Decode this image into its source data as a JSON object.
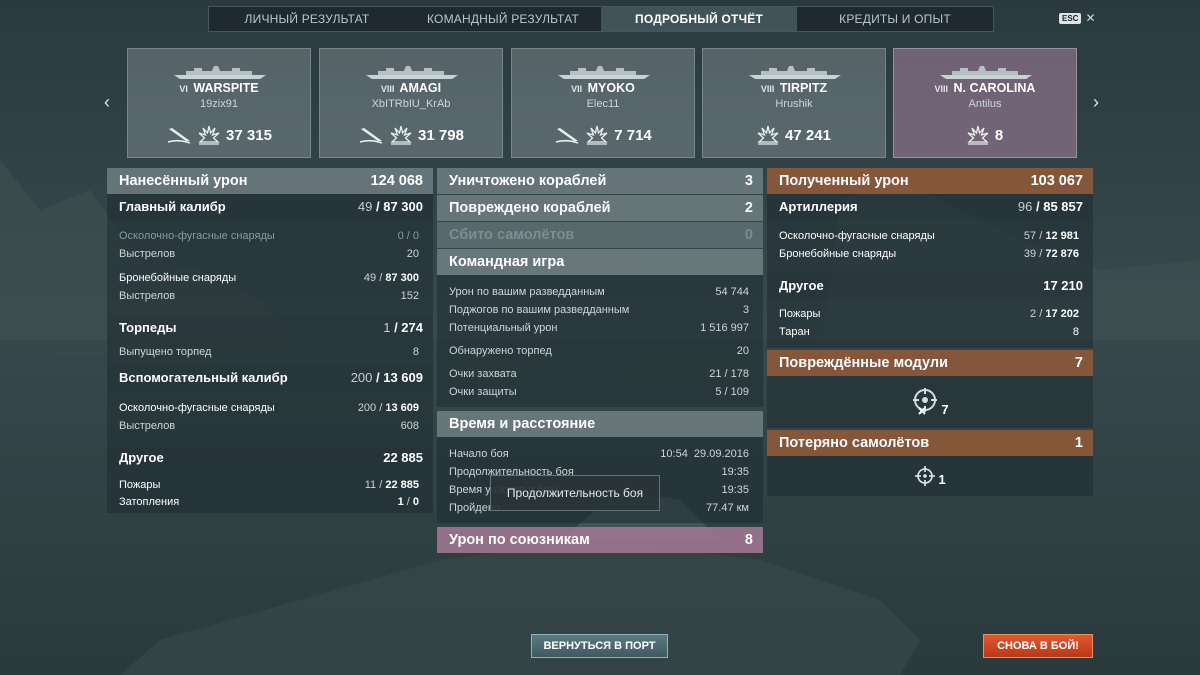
{
  "tabs": [
    "ЛИЧНЫЙ РЕЗУЛЬТАТ",
    "КОМАНДНЫЙ РЕЗУЛЬТАТ",
    "ПОДРОБНЫЙ ОТЧЁТ",
    "КРЕДИТЫ И ОПЫТ"
  ],
  "active_tab": "ПОДРОБНЫЙ ОТЧЁТ",
  "esc": {
    "key": "ESC",
    "close": "✕"
  },
  "nav": {
    "prev": "‹",
    "next": "›"
  },
  "cards": [
    {
      "tier": "VI",
      "name": "WARSPITE",
      "player": "19zix91",
      "value": "37 315",
      "killed": true,
      "player_card": false
    },
    {
      "tier": "VIII",
      "name": "AMAGI",
      "player": "XbITRbIU_KrAb",
      "value": "31 798",
      "killed": true,
      "player_card": false
    },
    {
      "tier": "VII",
      "name": "MYOKO",
      "player": "Elec11",
      "value": "7 714",
      "killed": true,
      "player_card": false
    },
    {
      "tier": "VIII",
      "name": "TIRPITZ",
      "player": "Hrushik",
      "value": "47 241",
      "killed": false,
      "player_card": false
    },
    {
      "tier": "VIII",
      "name": "N. CAROLINA",
      "player": "Antilus",
      "value": "8",
      "killed": false,
      "player_card": true
    }
  ],
  "left": {
    "damage": {
      "label": "Нанесённый урон",
      "value": "124 068"
    },
    "main": {
      "label": "Главный калибр",
      "hits": "49",
      "total": "87 300"
    },
    "main_he": {
      "label": "Осколочно-фугасные снаряды",
      "value": "0 / 0"
    },
    "main_he_shots": {
      "label": "Выстрелов",
      "value": "20"
    },
    "main_ap": {
      "label": "Бронебойные снаряды",
      "hits": "49",
      "total": "87 300"
    },
    "main_ap_shots": {
      "label": "Выстрелов",
      "value": "152"
    },
    "torp": {
      "label": "Торпеды",
      "hits": "1",
      "total": "274"
    },
    "torp_fired": {
      "label": "Выпущено торпед",
      "value": "8"
    },
    "sec": {
      "label": "Вспомогательный калибр",
      "hits": "200",
      "total": "13 609"
    },
    "sec_he": {
      "label": "Осколочно-фугасные снаряды",
      "hits": "200",
      "total": "13 609"
    },
    "sec_shots": {
      "label": "Выстрелов",
      "value": "608"
    },
    "other": {
      "label": "Другое",
      "value": "22 885"
    },
    "fires": {
      "label": "Пожары",
      "hits": "11",
      "total": "22 885"
    },
    "flood": {
      "label": "Затопления",
      "hits": "1",
      "total": "0"
    }
  },
  "middle": {
    "destroyed": {
      "label": "Уничтожено кораблей",
      "value": "3"
    },
    "damaged": {
      "label": "Повреждено кораблей",
      "value": "2"
    },
    "planes": {
      "label": "Сбито самолётов",
      "value": "0"
    },
    "team": {
      "label": "Командная игра"
    },
    "scout": {
      "label": "Урон по вашим разведданным",
      "value": "54 744"
    },
    "scout_fires": {
      "label": "Поджогов по вашим разведданным",
      "value": "3"
    },
    "potential": {
      "label": "Потенциальный урон",
      "value": "1 516 997"
    },
    "torp_spotted": {
      "label": "Обнаружено торпед",
      "value": "20"
    },
    "capture": {
      "label": "Очки захвата",
      "value": "21 / 178"
    },
    "defense": {
      "label": "Очки защиты",
      "value": "5 / 109"
    },
    "time": {
      "label": "Время и расстояние"
    },
    "start": {
      "label": "Начало боя",
      "value": "10:54  29.09.2016"
    },
    "duration": {
      "label": "Продолжительность боя",
      "value": "19:35"
    },
    "participation": {
      "label": "Время участия в бою",
      "value": "19:35"
    },
    "distance": {
      "label": "Пройдено",
      "value": "77.47 км"
    },
    "ally_dmg": {
      "label": "Урон по союзникам",
      "value": "8"
    }
  },
  "right": {
    "received": {
      "label": "Полученный урон",
      "value": "103 067"
    },
    "artillery": {
      "label": "Артиллерия",
      "hits": "96",
      "total": "85 857"
    },
    "r_he": {
      "label": "Осколочно-фугасные снаряды",
      "hits": "57",
      "total": "12 981"
    },
    "r_ap": {
      "label": "Бронебойные снаряды",
      "hits": "39",
      "total": "72 876"
    },
    "r_other": {
      "label": "Другое",
      "value": "17 210"
    },
    "r_fires": {
      "label": "Пожары",
      "hits": "2",
      "total": "17 202"
    },
    "r_ram": {
      "label": "Таран",
      "value": "8"
    },
    "modules": {
      "label": "Повреждённые модули",
      "value": "7",
      "icon_count": "7"
    },
    "planes_lost": {
      "label": "Потеряно самолётов",
      "value": "1",
      "icon_count": "1"
    }
  },
  "tooltip": "Продолжительность боя",
  "buttons": {
    "port": "ВЕРНУТЬСЯ В ПОРТ",
    "battle": "СНОВА В БОЙ!"
  },
  "colors": {
    "orange_header": "#8c583a",
    "pink_row": "#a5789a",
    "battle_button": "#d24a22",
    "port_button": "#4c6a70"
  }
}
